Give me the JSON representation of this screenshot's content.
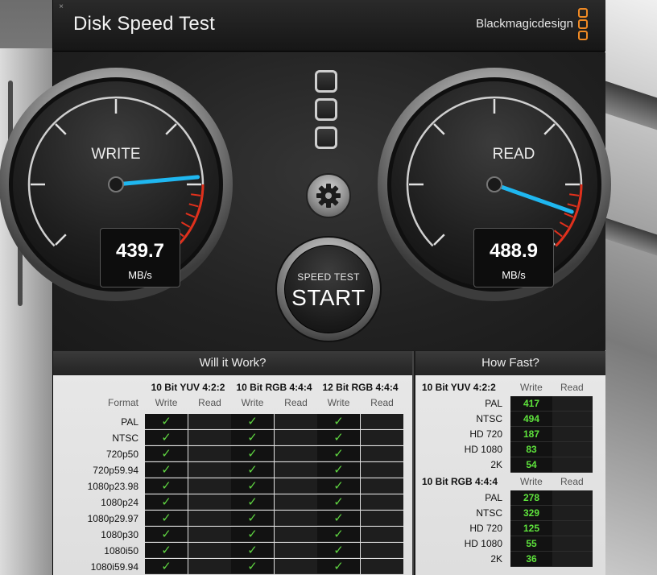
{
  "window": {
    "title": "Disk Speed Test",
    "brand": "Blackmagicdesign",
    "close_icon": "×"
  },
  "gauges": {
    "write": {
      "label": "WRITE",
      "value": "439.7",
      "unit": "MB/s",
      "reading": 439.7
    },
    "read": {
      "label": "READ",
      "value": "488.9",
      "unit": "MB/s",
      "reading": 488.9
    }
  },
  "controls": {
    "start_small": "SPEED TEST",
    "start_big": "START",
    "settings_icon": "gear-icon"
  },
  "will_it_work": {
    "title": "Will it Work?",
    "format_header": "Format",
    "groups": [
      {
        "name": "10 Bit YUV 4:2:2",
        "write": "Write",
        "read": "Read"
      },
      {
        "name": "10 Bit RGB 4:4:4",
        "write": "Write",
        "read": "Read"
      },
      {
        "name": "12 Bit RGB 4:4:4",
        "write": "Write",
        "read": "Read"
      }
    ],
    "formats": [
      "PAL",
      "NTSC",
      "720p50",
      "720p59.94",
      "1080p23.98",
      "1080p24",
      "1080p29.97",
      "1080p30",
      "1080i50",
      "1080i59.94"
    ],
    "check": "✓"
  },
  "how_fast": {
    "title": "How Fast?",
    "sections": [
      {
        "name": "10 Bit YUV 4:2:2",
        "write": "Write",
        "read": "Read",
        "rows": [
          {
            "label": "PAL",
            "value": "417"
          },
          {
            "label": "NTSC",
            "value": "494"
          },
          {
            "label": "HD 720",
            "value": "187"
          },
          {
            "label": "HD 1080",
            "value": "83"
          },
          {
            "label": "2K",
            "value": "54"
          }
        ]
      },
      {
        "name": "10 Bit RGB 4:4:4",
        "write": "Write",
        "read": "Read",
        "rows": [
          {
            "label": "PAL",
            "value": "278"
          },
          {
            "label": "NTSC",
            "value": "329"
          },
          {
            "label": "HD 720",
            "value": "125"
          },
          {
            "label": "HD 1080",
            "value": "55"
          },
          {
            "label": "2K",
            "value": "36"
          }
        ]
      }
    ]
  },
  "colors": {
    "accent_orange": "#f08a24",
    "needle_blue": "#1fb7f0",
    "redline": "#e0301c",
    "value_green": "#5ee33c"
  }
}
